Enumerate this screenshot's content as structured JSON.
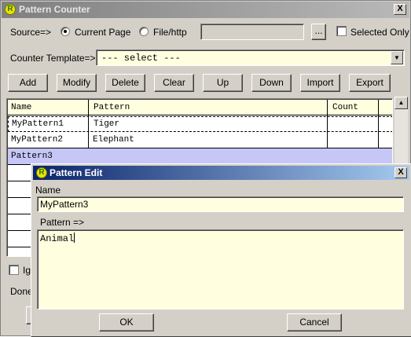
{
  "window": {
    "title": "Pattern Counter",
    "close": "X",
    "logo": "R"
  },
  "source": {
    "label": "Source=>",
    "option_current": "Current Page",
    "option_file": "File/http",
    "selected": "Current Page",
    "path_value": "",
    "browse_label": "...",
    "selected_only_label": "Selected Only",
    "selected_only_checked": false
  },
  "template": {
    "label": "Counter Template=>",
    "value": "--- select ---"
  },
  "toolbar": {
    "add": "Add",
    "modify": "Modify",
    "delete": "Delete",
    "clear": "Clear",
    "up": "Up",
    "down": "Down",
    "import": "Import",
    "export": "Export"
  },
  "table": {
    "headers": {
      "name": "Name",
      "pattern": "Pattern",
      "count": "Count"
    },
    "rows": [
      {
        "name": "MyPattern1",
        "pattern": "Tiger",
        "count": ""
      },
      {
        "name": "MyPattern2",
        "pattern": "Elephant",
        "count": ""
      },
      {
        "name": "Pattern3",
        "pattern": "",
        "count": ""
      }
    ],
    "selected_row": 2
  },
  "bottom": {
    "checkbox_label_partial": "Ig",
    "status_partial": "Done"
  },
  "dialog": {
    "title": "Pattern Edit",
    "close": "X",
    "logo": "R",
    "name_label": "Name",
    "name_value": "MyPattern3",
    "pattern_label": "Pattern =>",
    "pattern_value": "Animal",
    "ok": "OK",
    "cancel": "Cancel"
  },
  "colors": {
    "field_bg": "#ffffe0",
    "selection": "#c6c6f7",
    "dialog_title": "#0a246a"
  }
}
